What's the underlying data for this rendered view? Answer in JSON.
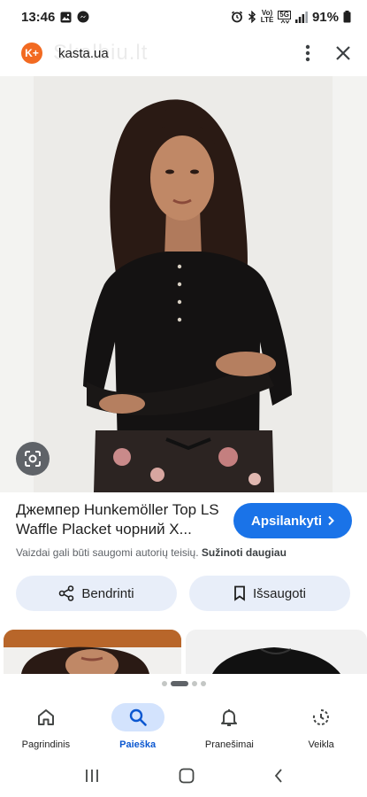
{
  "status_bar": {
    "time": "13:46",
    "battery": "91%",
    "network_label_top": "Vo)",
    "network_label_bottom": "LTE",
    "network_gen": "5G"
  },
  "header": {
    "site_name": "kasta.ua",
    "logo_text": "K+",
    "watermark": "Skelbiu.lt"
  },
  "product": {
    "title": "Джемпер Hunkemöller Top LS Waffle Placket чорний X...",
    "visit_label": "Apsilankyti",
    "copyright_note": "Vaizdai gali būti saugomi autorių teisių.",
    "learn_more": "Sužinoti daugiau"
  },
  "actions": {
    "share_label": "Bendrinti",
    "save_label": "Išsaugoti"
  },
  "bottom_nav": {
    "items": [
      {
        "label": "Pagrindinis",
        "icon": "home-icon"
      },
      {
        "label": "Paieška",
        "icon": "search-icon"
      },
      {
        "label": "Pranešimai",
        "icon": "bell-icon"
      },
      {
        "label": "Veikla",
        "icon": "activity-icon"
      }
    ],
    "active_index": 1
  },
  "colors": {
    "accent": "#1a73e8",
    "pill_bg": "#e8eef9",
    "active_nav_bg": "#d3e3fd",
    "logo_orange": "#f26a21"
  }
}
